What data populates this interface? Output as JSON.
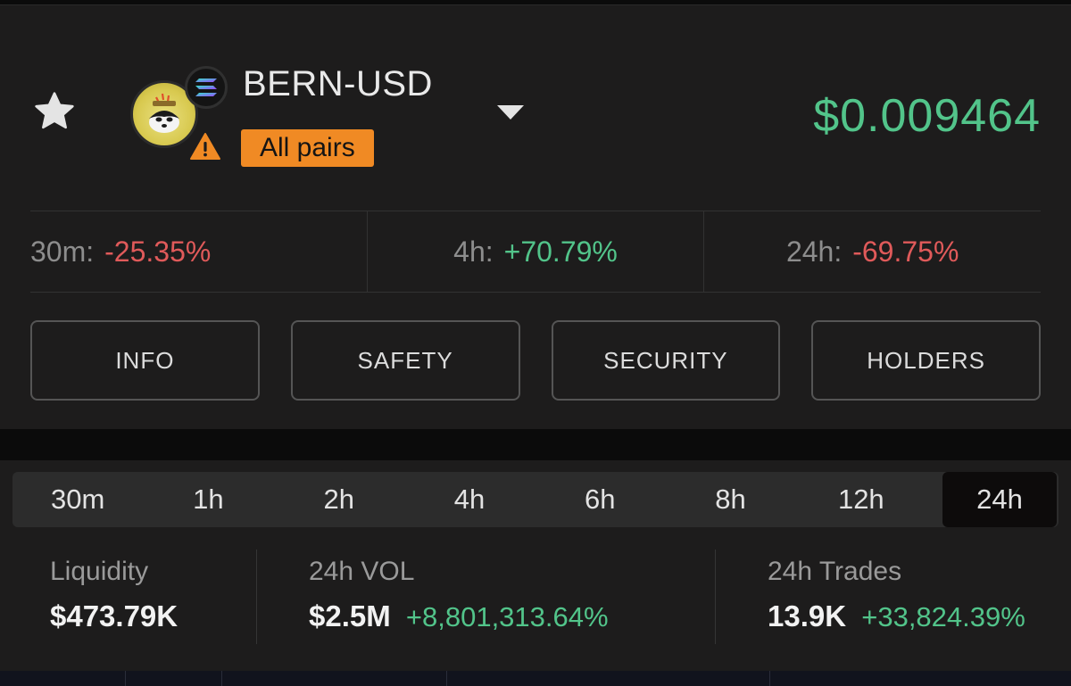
{
  "header": {
    "pair_title": "BERN-USD",
    "all_pairs_label": "All pairs",
    "price": "$0.009464",
    "price_color": "#52c48a",
    "icons": {
      "favorite": "star-icon",
      "token": "token-avatar",
      "chain": "solana-icon",
      "warning": "warning-icon",
      "dropdown": "chevron-down-icon"
    }
  },
  "changes": [
    {
      "label": "30m:",
      "value": "-25.35%",
      "direction": "down"
    },
    {
      "label": "4h:",
      "value": "+70.79%",
      "direction": "up"
    },
    {
      "label": "24h:",
      "value": "-69.75%",
      "direction": "down"
    }
  ],
  "tabs": [
    {
      "label": "INFO"
    },
    {
      "label": "SAFETY"
    },
    {
      "label": "SECURITY"
    },
    {
      "label": "HOLDERS"
    }
  ],
  "timeframes": {
    "options": [
      "30m",
      "1h",
      "2h",
      "4h",
      "6h",
      "8h",
      "12h",
      "24h"
    ],
    "selected": "24h"
  },
  "stats": {
    "liquidity": {
      "label": "Liquidity",
      "value": "$473.79K"
    },
    "volume": {
      "label": "24h VOL",
      "value": "$2.5M",
      "change": "+8,801,313.64%"
    },
    "trades": {
      "label": "24h Trades",
      "value": "13.9K",
      "change": "+33,824.39%"
    }
  },
  "colors": {
    "positive": "#52c48a",
    "negative": "#e05a5a",
    "accent": "#f08a24",
    "panel": "#1d1c1c"
  }
}
